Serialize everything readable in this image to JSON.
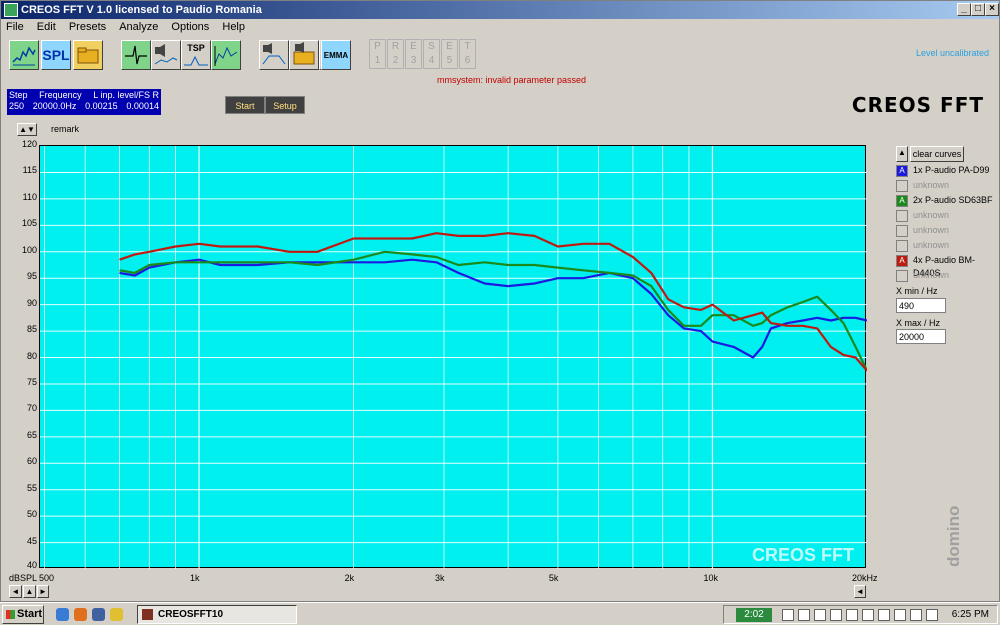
{
  "window": {
    "title": "CREOS FFT V 1.0   licensed to Paudio Romania"
  },
  "menu": [
    "File",
    "Edit",
    "Presets",
    "Analyze",
    "Options",
    "Help"
  ],
  "toolbar": {
    "spl_label": "SPL",
    "tsp_label": "TSP",
    "emma_label": "EMMA",
    "presets_letters": [
      "P",
      "R",
      "E",
      "S",
      "E",
      "T"
    ],
    "presets_numbers": [
      "1",
      "2",
      "3",
      "4",
      "5",
      "6"
    ],
    "level_message": "Level uncalibrated"
  },
  "error_message": "mmsystem: invalid parameter passed",
  "info": {
    "step_label": "Step",
    "step_value": "250",
    "freq_label": "Frequency",
    "freq_value": "20000.0Hz",
    "level_label": "L inp. level/FS R",
    "level_l": "0.00215",
    "level_r": "0.00014"
  },
  "buttons": {
    "start": "Start",
    "setup": "Setup"
  },
  "logo": "CREOS FFT",
  "remark_label": "remark",
  "colors": {
    "plot_bg": "#00f0f0",
    "blue": "#1a1ae0",
    "green": "#1a8a1a",
    "red": "#c01a10"
  },
  "chart_data": {
    "type": "line",
    "xscale": "log",
    "xlim": [
      490,
      20000
    ],
    "ylim": [
      40,
      120
    ],
    "ylabel": "dBSPL",
    "y_ticks": [
      "120",
      "115",
      "110",
      "105",
      "100",
      "95",
      "90",
      "85",
      "80",
      "75",
      "70",
      "65",
      "60",
      "55",
      "50",
      "45",
      "40"
    ],
    "x_ticks": [
      "500",
      "1k",
      "2k",
      "3k",
      "5k",
      "10k",
      "20kHz"
    ],
    "watermark": "CREOS FFT",
    "grid": true,
    "series": [
      {
        "name": "1x P-audio PA-D99",
        "color": "#1a1ae0",
        "x": [
          700,
          750,
          800,
          900,
          1000,
          1100,
          1300,
          1500,
          1700,
          2000,
          2300,
          2600,
          2900,
          3200,
          3600,
          4000,
          4500,
          5000,
          5600,
          6300,
          7000,
          7600,
          8200,
          8800,
          9500,
          10000,
          11000,
          12000,
          12500,
          13000,
          14000,
          15000,
          16000,
          17000,
          18000,
          19000,
          20000
        ],
        "y": [
          96,
          95.5,
          97,
          98,
          98.5,
          97.5,
          97.5,
          98,
          98,
          98,
          98,
          98.5,
          98,
          96,
          94,
          93.5,
          94,
          95,
          95,
          96,
          95,
          92,
          88,
          85.5,
          85,
          83,
          82,
          80,
          82,
          85.5,
          86.5,
          87,
          87.5,
          87,
          87.5,
          87.5,
          87
        ]
      },
      {
        "name": "2x P-audio SD63BF",
        "color": "#1a8a1a",
        "x": [
          700,
          750,
          800,
          900,
          1000,
          1100,
          1300,
          1500,
          1700,
          2000,
          2300,
          2600,
          2900,
          3200,
          3600,
          4000,
          4500,
          5000,
          5600,
          6300,
          7000,
          7600,
          8200,
          8800,
          9500,
          10000,
          11000,
          12000,
          12500,
          13000,
          14000,
          15000,
          16000,
          17000,
          18000,
          19000,
          20000
        ],
        "y": [
          96.5,
          96,
          97.5,
          98,
          98,
          98,
          98,
          98,
          97.5,
          98.5,
          100,
          99.5,
          99,
          97.5,
          98,
          97.5,
          97.5,
          97,
          96.5,
          96,
          95.5,
          93.5,
          89,
          86,
          86,
          88,
          88,
          86,
          86.5,
          88,
          89.5,
          90.5,
          91.5,
          89,
          86.5,
          82,
          77.5
        ]
      },
      {
        "name": "4x P-audio BM-D440S",
        "color": "#c01a10",
        "x": [
          700,
          750,
          800,
          900,
          1000,
          1100,
          1300,
          1500,
          1700,
          2000,
          2300,
          2600,
          2900,
          3200,
          3600,
          4000,
          4500,
          5000,
          5600,
          6300,
          7000,
          7600,
          8200,
          8800,
          9500,
          10000,
          11000,
          12000,
          12500,
          13000,
          14000,
          15000,
          16000,
          17000,
          18000,
          19000,
          20000
        ],
        "y": [
          98.5,
          99.5,
          100,
          101,
          101.5,
          101,
          101,
          100,
          100,
          102.5,
          102.5,
          102.5,
          103.5,
          103,
          103,
          103.5,
          103,
          101,
          101.5,
          101.5,
          99,
          96,
          91,
          89.5,
          89,
          90,
          87,
          88,
          88.5,
          86.5,
          86,
          86,
          85.5,
          82,
          80.5,
          80,
          77.5
        ]
      }
    ]
  },
  "side": {
    "clear_label": "clear curves",
    "legend": [
      {
        "marker": "A",
        "label": "1x P-audio PA-D99",
        "color": "#1a1ae0",
        "active": true
      },
      {
        "marker": "",
        "label": "unknown",
        "color": "#d4d0c8",
        "active": false
      },
      {
        "marker": "A",
        "label": "2x P-audio SD63BF",
        "color": "#1a8a1a",
        "active": true
      },
      {
        "marker": "",
        "label": "unknown",
        "color": "#d4d0c8",
        "active": false
      },
      {
        "marker": "",
        "label": "unknown",
        "color": "#d4d0c8",
        "active": false
      },
      {
        "marker": "",
        "label": "unknown",
        "color": "#d4d0c8",
        "active": false
      },
      {
        "marker": "A",
        "label": "4x P-audio BM-D440S",
        "color": "#c01a10",
        "active": true
      },
      {
        "marker": "",
        "label": "unknown",
        "color": "#d4d0c8",
        "active": false
      }
    ],
    "xmin_label": "X min / Hz",
    "xmin_value": "490",
    "xmax_label": "X max / Hz",
    "xmax_value": "20000"
  },
  "domino_text": "domino",
  "taskbar": {
    "start": "Start",
    "task_item": "CREOSFFT10",
    "tray_time_box": "2:02",
    "clock": "6:25 PM"
  }
}
